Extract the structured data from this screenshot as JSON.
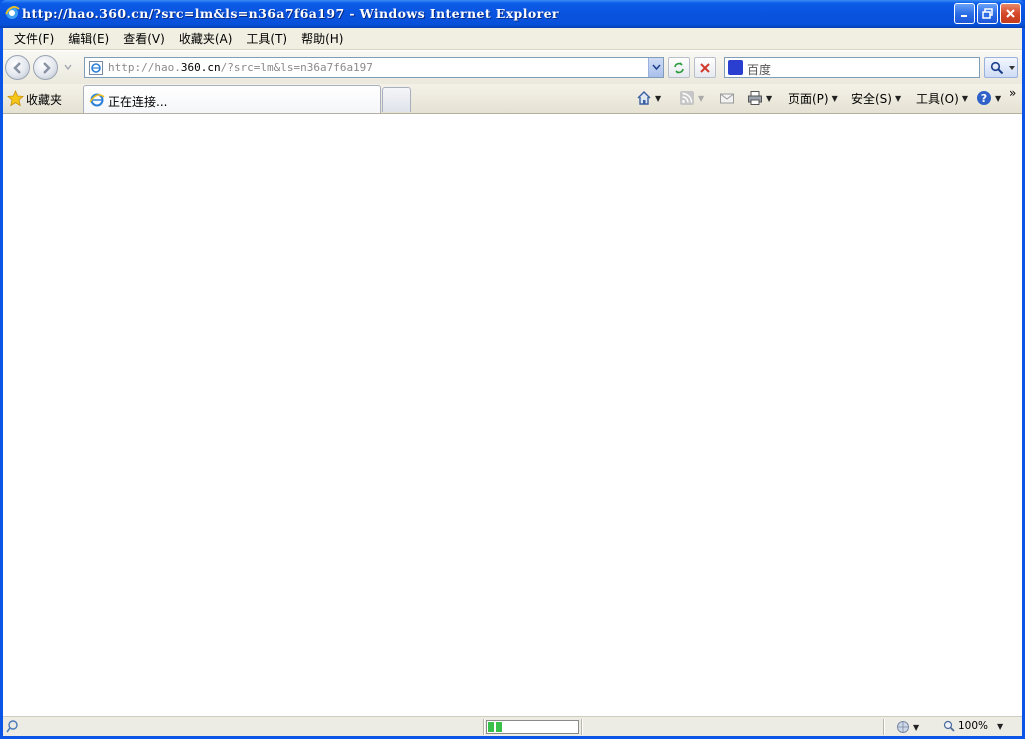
{
  "window": {
    "title": "http://hao.360.cn/?src=lm&ls=n36a7f6a197 - Windows Internet Explorer"
  },
  "menu": {
    "items": [
      "文件(F)",
      "编辑(E)",
      "查看(V)",
      "收藏夹(A)",
      "工具(T)",
      "帮助(H)"
    ]
  },
  "address": {
    "prefix": "http://hao.",
    "host": "360.cn",
    "suffix": "/?src=lm&ls=n36a7f6a197"
  },
  "search": {
    "placeholder": "百度",
    "engine_icon": "baidu-paw-icon"
  },
  "favorites": {
    "label": "收藏夹"
  },
  "tabs": [
    {
      "label": "正在连接...",
      "icon": "ie-page-icon"
    }
  ],
  "commands": {
    "page": "页面(P)",
    "safety": "安全(S)",
    "tools": "工具(O)"
  },
  "status": {
    "progress": 0.16,
    "zoom": "100%"
  },
  "colors": {
    "titlebar": "#0a53df",
    "progress_fill": "#38c04a"
  }
}
